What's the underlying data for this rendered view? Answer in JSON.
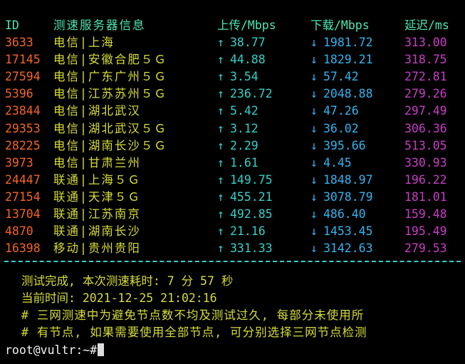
{
  "colors": {
    "background": "#000000",
    "header": "#4de6b0",
    "node_id": "#f46522",
    "node_name": "#d6dc3a",
    "upload": "#34d0c8",
    "download": "#33b3ee",
    "latency": "#c93cc6",
    "summary": "#d6dc3a",
    "prompt": "#f3f3f3"
  },
  "header": {
    "id": "ID",
    "name": "测速服务器信息",
    "upload": "上传/Mbps",
    "download": "下载/Mbps",
    "latency": "延迟/ms"
  },
  "arrows": {
    "up": "↑",
    "down": "↓"
  },
  "rows": [
    {
      "id": "3633",
      "name": "电信|上海",
      "upload": "38.77",
      "download": "1981.72",
      "latency": "313.00"
    },
    {
      "id": "17145",
      "name": "电信|安徽合肥５Ｇ",
      "upload": "44.88",
      "download": "1829.21",
      "latency": "318.75"
    },
    {
      "id": "27594",
      "name": "电信|广东广州５Ｇ",
      "upload": "3.54",
      "download": "57.42",
      "latency": "272.81"
    },
    {
      "id": "5396",
      "name": "电信|江苏苏州５Ｇ",
      "upload": "236.72",
      "download": "2048.88",
      "latency": "279.26"
    },
    {
      "id": "23844",
      "name": "电信|湖北武汉",
      "upload": "5.42",
      "download": "47.26",
      "latency": "297.49"
    },
    {
      "id": "29353",
      "name": "电信|湖北武汉５Ｇ",
      "upload": "3.12",
      "download": "36.02",
      "latency": "306.36"
    },
    {
      "id": "28225",
      "name": "电信|湖南长沙５Ｇ",
      "upload": "2.29",
      "download": "395.66",
      "latency": "513.05"
    },
    {
      "id": "3973",
      "name": "电信|甘肃兰州",
      "upload": "1.61",
      "download": "4.45",
      "latency": "330.93"
    },
    {
      "id": "24447",
      "name": "联通|上海５Ｇ",
      "upload": "149.75",
      "download": "1848.97",
      "latency": "196.22"
    },
    {
      "id": "27154",
      "name": "联通|天津５Ｇ",
      "upload": "455.21",
      "download": "3078.79",
      "latency": "181.01"
    },
    {
      "id": "13704",
      "name": "联通|江苏南京",
      "upload": "492.85",
      "download": "486.40",
      "latency": "159.48"
    },
    {
      "id": "4870",
      "name": "联通|湖南长沙",
      "upload": "21.16",
      "download": "1453.45",
      "latency": "195.49"
    },
    {
      "id": "16398",
      "name": "移动|贵州贵阳",
      "upload": "331.33",
      "download": "3142.63",
      "latency": "279.53"
    }
  ],
  "summary": {
    "done": "测试完成, 本次测速耗时: 7 分 57 秒",
    "current_time": "当前时间: 2021-12-25 21:02:16",
    "note_line1": "# 三网测速中为避免节点数不均及测试过久, 每部分未使用所",
    "note_line2": "# 有节点, 如果需要使用全部节点, 可分别选择三网节点检测"
  },
  "prompt": "root@vultr:~#"
}
